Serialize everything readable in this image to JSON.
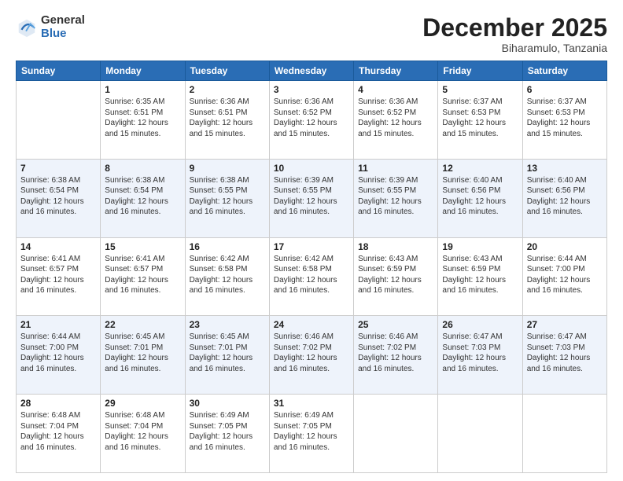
{
  "logo": {
    "general": "General",
    "blue": "Blue"
  },
  "header": {
    "month": "December 2025",
    "location": "Biharamulo, Tanzania"
  },
  "weekdays": [
    "Sunday",
    "Monday",
    "Tuesday",
    "Wednesday",
    "Thursday",
    "Friday",
    "Saturday"
  ],
  "weeks": [
    [
      {
        "day": "",
        "sunrise": "",
        "sunset": "",
        "daylight": ""
      },
      {
        "day": "1",
        "sunrise": "Sunrise: 6:35 AM",
        "sunset": "Sunset: 6:51 PM",
        "daylight": "Daylight: 12 hours and 15 minutes."
      },
      {
        "day": "2",
        "sunrise": "Sunrise: 6:36 AM",
        "sunset": "Sunset: 6:51 PM",
        "daylight": "Daylight: 12 hours and 15 minutes."
      },
      {
        "day": "3",
        "sunrise": "Sunrise: 6:36 AM",
        "sunset": "Sunset: 6:52 PM",
        "daylight": "Daylight: 12 hours and 15 minutes."
      },
      {
        "day": "4",
        "sunrise": "Sunrise: 6:36 AM",
        "sunset": "Sunset: 6:52 PM",
        "daylight": "Daylight: 12 hours and 15 minutes."
      },
      {
        "day": "5",
        "sunrise": "Sunrise: 6:37 AM",
        "sunset": "Sunset: 6:53 PM",
        "daylight": "Daylight: 12 hours and 15 minutes."
      },
      {
        "day": "6",
        "sunrise": "Sunrise: 6:37 AM",
        "sunset": "Sunset: 6:53 PM",
        "daylight": "Daylight: 12 hours and 15 minutes."
      }
    ],
    [
      {
        "day": "7",
        "sunrise": "Sunrise: 6:38 AM",
        "sunset": "Sunset: 6:54 PM",
        "daylight": "Daylight: 12 hours and 16 minutes."
      },
      {
        "day": "8",
        "sunrise": "Sunrise: 6:38 AM",
        "sunset": "Sunset: 6:54 PM",
        "daylight": "Daylight: 12 hours and 16 minutes."
      },
      {
        "day": "9",
        "sunrise": "Sunrise: 6:38 AM",
        "sunset": "Sunset: 6:55 PM",
        "daylight": "Daylight: 12 hours and 16 minutes."
      },
      {
        "day": "10",
        "sunrise": "Sunrise: 6:39 AM",
        "sunset": "Sunset: 6:55 PM",
        "daylight": "Daylight: 12 hours and 16 minutes."
      },
      {
        "day": "11",
        "sunrise": "Sunrise: 6:39 AM",
        "sunset": "Sunset: 6:55 PM",
        "daylight": "Daylight: 12 hours and 16 minutes."
      },
      {
        "day": "12",
        "sunrise": "Sunrise: 6:40 AM",
        "sunset": "Sunset: 6:56 PM",
        "daylight": "Daylight: 12 hours and 16 minutes."
      },
      {
        "day": "13",
        "sunrise": "Sunrise: 6:40 AM",
        "sunset": "Sunset: 6:56 PM",
        "daylight": "Daylight: 12 hours and 16 minutes."
      }
    ],
    [
      {
        "day": "14",
        "sunrise": "Sunrise: 6:41 AM",
        "sunset": "Sunset: 6:57 PM",
        "daylight": "Daylight: 12 hours and 16 minutes."
      },
      {
        "day": "15",
        "sunrise": "Sunrise: 6:41 AM",
        "sunset": "Sunset: 6:57 PM",
        "daylight": "Daylight: 12 hours and 16 minutes."
      },
      {
        "day": "16",
        "sunrise": "Sunrise: 6:42 AM",
        "sunset": "Sunset: 6:58 PM",
        "daylight": "Daylight: 12 hours and 16 minutes."
      },
      {
        "day": "17",
        "sunrise": "Sunrise: 6:42 AM",
        "sunset": "Sunset: 6:58 PM",
        "daylight": "Daylight: 12 hours and 16 minutes."
      },
      {
        "day": "18",
        "sunrise": "Sunrise: 6:43 AM",
        "sunset": "Sunset: 6:59 PM",
        "daylight": "Daylight: 12 hours and 16 minutes."
      },
      {
        "day": "19",
        "sunrise": "Sunrise: 6:43 AM",
        "sunset": "Sunset: 6:59 PM",
        "daylight": "Daylight: 12 hours and 16 minutes."
      },
      {
        "day": "20",
        "sunrise": "Sunrise: 6:44 AM",
        "sunset": "Sunset: 7:00 PM",
        "daylight": "Daylight: 12 hours and 16 minutes."
      }
    ],
    [
      {
        "day": "21",
        "sunrise": "Sunrise: 6:44 AM",
        "sunset": "Sunset: 7:00 PM",
        "daylight": "Daylight: 12 hours and 16 minutes."
      },
      {
        "day": "22",
        "sunrise": "Sunrise: 6:45 AM",
        "sunset": "Sunset: 7:01 PM",
        "daylight": "Daylight: 12 hours and 16 minutes."
      },
      {
        "day": "23",
        "sunrise": "Sunrise: 6:45 AM",
        "sunset": "Sunset: 7:01 PM",
        "daylight": "Daylight: 12 hours and 16 minutes."
      },
      {
        "day": "24",
        "sunrise": "Sunrise: 6:46 AM",
        "sunset": "Sunset: 7:02 PM",
        "daylight": "Daylight: 12 hours and 16 minutes."
      },
      {
        "day": "25",
        "sunrise": "Sunrise: 6:46 AM",
        "sunset": "Sunset: 7:02 PM",
        "daylight": "Daylight: 12 hours and 16 minutes."
      },
      {
        "day": "26",
        "sunrise": "Sunrise: 6:47 AM",
        "sunset": "Sunset: 7:03 PM",
        "daylight": "Daylight: 12 hours and 16 minutes."
      },
      {
        "day": "27",
        "sunrise": "Sunrise: 6:47 AM",
        "sunset": "Sunset: 7:03 PM",
        "daylight": "Daylight: 12 hours and 16 minutes."
      }
    ],
    [
      {
        "day": "28",
        "sunrise": "Sunrise: 6:48 AM",
        "sunset": "Sunset: 7:04 PM",
        "daylight": "Daylight: 12 hours and 16 minutes."
      },
      {
        "day": "29",
        "sunrise": "Sunrise: 6:48 AM",
        "sunset": "Sunset: 7:04 PM",
        "daylight": "Daylight: 12 hours and 16 minutes."
      },
      {
        "day": "30",
        "sunrise": "Sunrise: 6:49 AM",
        "sunset": "Sunset: 7:05 PM",
        "daylight": "Daylight: 12 hours and 16 minutes."
      },
      {
        "day": "31",
        "sunrise": "Sunrise: 6:49 AM",
        "sunset": "Sunset: 7:05 PM",
        "daylight": "Daylight: 12 hours and 16 minutes."
      },
      {
        "day": "",
        "sunrise": "",
        "sunset": "",
        "daylight": ""
      },
      {
        "day": "",
        "sunrise": "",
        "sunset": "",
        "daylight": ""
      },
      {
        "day": "",
        "sunrise": "",
        "sunset": "",
        "daylight": ""
      }
    ]
  ]
}
